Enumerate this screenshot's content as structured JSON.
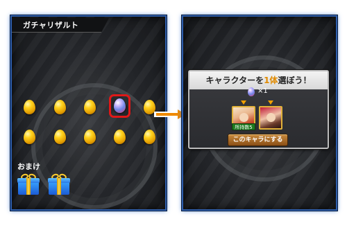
{
  "left_panel": {
    "title": "ガチャリザルト",
    "bonus_label": "おまけ",
    "eggs": [
      {
        "kind": "gold"
      },
      {
        "kind": "gold"
      },
      {
        "kind": "gold"
      },
      {
        "kind": "rainbow",
        "selected": true
      },
      {
        "kind": "gold"
      },
      {
        "kind": "gold"
      },
      {
        "kind": "gold"
      },
      {
        "kind": "gold"
      },
      {
        "kind": "gold"
      },
      {
        "kind": "gold"
      }
    ],
    "gifts": 2
  },
  "arrow_color": "#f08a00",
  "dialog": {
    "title_pre": "キャラクターを",
    "title_highlight": "1体",
    "title_post": "選ぼう！",
    "cost_label": "×1",
    "badge_text": "所持数5",
    "confirm_label": "このキャラにする"
  },
  "colors": {
    "frame_border": "#2f5fae",
    "selector": "#e01818",
    "highlight": "#e08a00"
  }
}
